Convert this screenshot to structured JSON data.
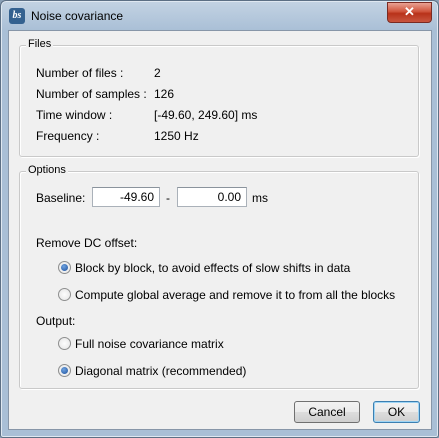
{
  "window": {
    "title": "Noise covariance",
    "app_icon": "bs",
    "close_glyph": "✕"
  },
  "files": {
    "group_label": "Files",
    "rows": [
      {
        "label": "Number of files :",
        "value": "2"
      },
      {
        "label": "Number of samples :",
        "value": "126"
      },
      {
        "label": "Time window :",
        "value": "[-49.60, 249.60] ms"
      },
      {
        "label": "Frequency :",
        "value": "1250 Hz"
      }
    ]
  },
  "options": {
    "group_label": "Options",
    "baseline": {
      "label": "Baseline:",
      "start": "-49.60",
      "separator": "-",
      "end": "0.00",
      "unit": "ms"
    },
    "dc_offset": {
      "label": "Remove DC offset:",
      "choices": [
        {
          "label": "Block by block, to avoid effects of slow shifts in data",
          "checked": true
        },
        {
          "label": "Compute global average and remove it to from all the blocks",
          "checked": false
        }
      ]
    },
    "output": {
      "label": "Output:",
      "choices": [
        {
          "label": "Full noise covariance matrix",
          "checked": false
        },
        {
          "label": "Diagonal matrix  (recommended)",
          "checked": true
        }
      ]
    }
  },
  "buttons": {
    "cancel": "Cancel",
    "ok": "OK"
  }
}
